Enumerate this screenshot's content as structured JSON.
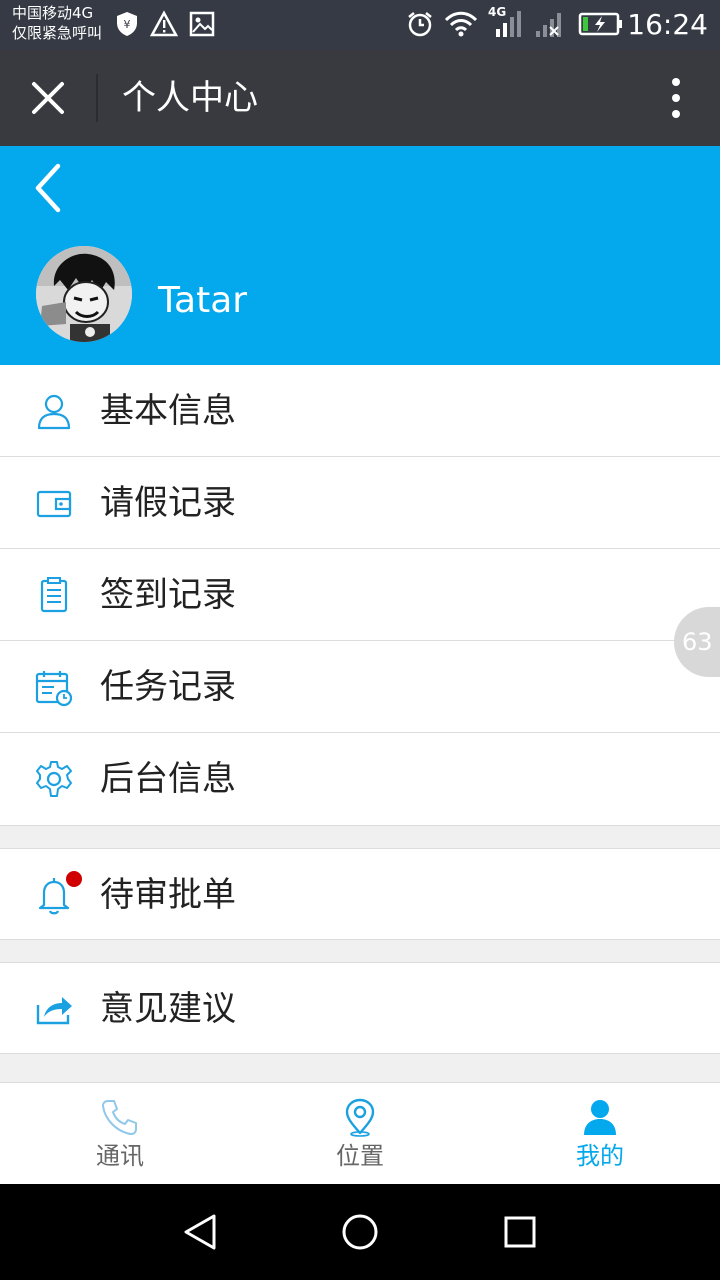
{
  "status_bar": {
    "carrier_line1": "中国移动4G",
    "carrier_line2": "仅限紧急呼叫",
    "network_label": "4G",
    "time": "16:24",
    "icons_left": [
      "shield-icon",
      "warning-icon",
      "image-icon"
    ],
    "icons_right": [
      "alarm-icon",
      "wifi-icon",
      "signal-icon",
      "signal-off-icon",
      "battery-charging-icon"
    ]
  },
  "titlebar": {
    "title": "个人中心",
    "close_icon": "close-icon",
    "more_icon": "more-vertical-icon"
  },
  "profile": {
    "username": "Tatar",
    "back_icon": "back-chevron-icon",
    "accent_color": "#04a8ec"
  },
  "menu": {
    "group1": [
      {
        "label": "基本信息",
        "icon": "user-icon"
      },
      {
        "label": "请假记录",
        "icon": "wallet-icon"
      },
      {
        "label": "签到记录",
        "icon": "clipboard-icon"
      },
      {
        "label": "任务记录",
        "icon": "calendar-clock-icon"
      },
      {
        "label": "后台信息",
        "icon": "gear-icon"
      }
    ],
    "group2": [
      {
        "label": "待审批单",
        "icon": "bell-icon",
        "has_badge": true,
        "badge_color": "#d00000"
      }
    ],
    "group3": [
      {
        "label": "意见建议",
        "icon": "share-icon"
      }
    ]
  },
  "floater": {
    "value": "63"
  },
  "bottom_nav": {
    "tabs": [
      {
        "label": "通讯",
        "icon": "phone-icon",
        "active": false
      },
      {
        "label": "位置",
        "icon": "location-pin-icon",
        "active": false
      },
      {
        "label": "我的",
        "icon": "person-icon",
        "active": true
      }
    ]
  },
  "system_nav": [
    "back-triangle-icon",
    "home-circle-icon",
    "recents-square-icon"
  ]
}
